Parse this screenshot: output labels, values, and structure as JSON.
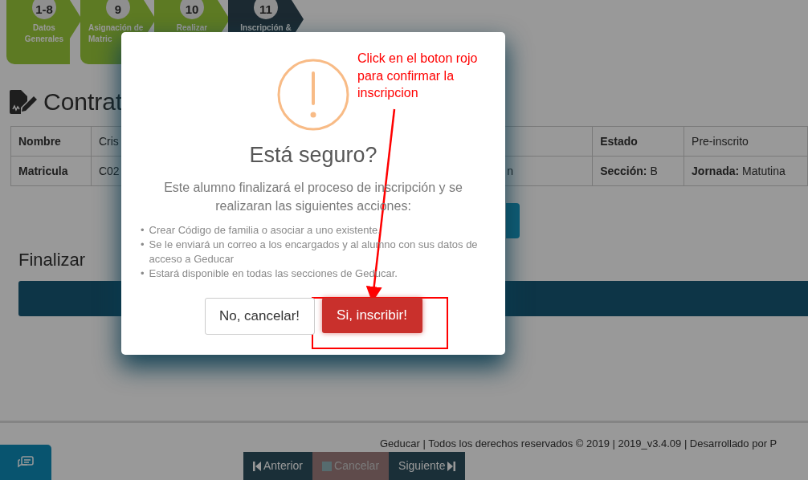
{
  "steps": [
    {
      "number": "1-8",
      "label": "Datos Generales",
      "selected": false
    },
    {
      "number": "9",
      "label": "Asignación de Matric",
      "selected": false
    },
    {
      "number": "10",
      "label": "Realizar",
      "selected": false
    },
    {
      "number": "11",
      "label": "Inscripción &",
      "selected": true
    }
  ],
  "section_title": "Contrat",
  "student_table": [
    {
      "label": "Nombre",
      "value": "Cris",
      "label_2": "Estado",
      "value_2": "Pre-inscrito"
    },
    {
      "label": "Matricula",
      "value": "C02",
      "middle": "n",
      "label_2": "**Sección:** B",
      "value_2": "**Jornada:** Matutina"
    }
  ],
  "finalize_title": "Finalizar",
  "footer": "Geducar | Todos los derechos reservados © 2019 | 2019_v3.4.09 | Desarrollado por P",
  "nav_buttons": [
    {
      "kind": "prev",
      "label": "Anterior",
      "disabled": false
    },
    {
      "kind": "stop",
      "label": "Cancelar",
      "disabled": true
    },
    {
      "kind": "next",
      "label": "Siguiente",
      "disabled": false
    }
  ],
  "dialog": {
    "title": "Está seguro?",
    "message": "Este alumno finalizará el proceso de inscripción y se realizaran las siguientes acciones:",
    "actions": [
      "Crear Código de familia o asociar a uno existente.",
      "Se le enviará un correo a los encargados y al alumno con sus datos de acceso a Geducar",
      "Estará disponible en todas las secciones de Geducar."
    ],
    "bullet": "•",
    "cancel_button": "No, cancelar!",
    "confirm_button": "Si, inscribir!"
  },
  "annotation": {
    "text": "Click en el boton rojo para confirmar la inscripcion"
  }
}
